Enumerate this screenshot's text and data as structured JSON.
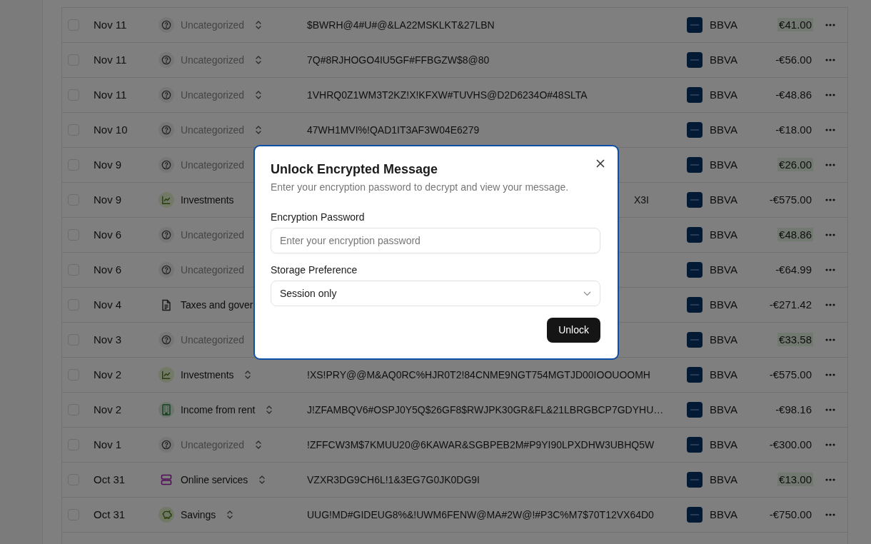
{
  "transactions": [
    {
      "selected": false,
      "date": "Nov 11",
      "category": {
        "kind": "uncategorized",
        "label": "Uncategorized"
      },
      "sorter": true,
      "description": "$BWRH@4#U#@&LA22MSKLKT&27LBN",
      "covered": false,
      "bank": "BBVA",
      "amount": "€41.00",
      "positive": true
    },
    {
      "selected": false,
      "date": "Nov 11",
      "category": {
        "kind": "uncategorized",
        "label": "Uncategorized"
      },
      "sorter": true,
      "description": "7Q#8RJHOGO4IU5GF#FFBGZW$8@80",
      "covered": false,
      "bank": "BBVA",
      "amount": "-€56.00",
      "positive": false
    },
    {
      "selected": false,
      "date": "Nov 11",
      "category": {
        "kind": "uncategorized",
        "label": "Uncategorized"
      },
      "sorter": true,
      "description": "1VHRQ0Z1WM3T2KZ!X!KFXW#TUVHS@D2D6234O#48SLTA",
      "covered": false,
      "bank": "BBVA",
      "amount": "-€48.86",
      "positive": false
    },
    {
      "selected": false,
      "date": "Nov 10",
      "category": {
        "kind": "uncategorized",
        "label": "Uncategorized"
      },
      "sorter": true,
      "description": "47WH1MVI%!QAD1IT3AF3W04E6279",
      "covered": false,
      "bank": "BBVA",
      "amount": "-€18.00",
      "positive": false
    },
    {
      "selected": false,
      "date": "Nov 9",
      "category": {
        "kind": "uncategorized",
        "label": "Uncategorized"
      },
      "sorter": false,
      "bank": "BBVA",
      "amount": "€26.00",
      "positive": true
    },
    {
      "selected": false,
      "date": "Nov 9",
      "category": {
        "kind": "investments",
        "label": "Investments"
      },
      "sorter": false,
      "description": "X3I",
      "covered": true,
      "bank": "BBVA",
      "amount": "-€575.00",
      "positive": false
    },
    {
      "selected": false,
      "date": "Nov 6",
      "category": {
        "kind": "uncategorized",
        "label": "Uncategorized"
      },
      "sorter": false,
      "bank": "BBVA",
      "amount": "€48.86",
      "positive": true
    },
    {
      "selected": false,
      "date": "Nov 6",
      "category": {
        "kind": "uncategorized",
        "label": "Uncategorized"
      },
      "sorter": false,
      "bank": "BBVA",
      "amount": "-€64.99",
      "positive": false
    },
    {
      "selected": false,
      "date": "Nov 4",
      "category": {
        "kind": "document",
        "label": "Taxes and gover"
      },
      "sorter": false,
      "bank": "BBVA",
      "amount": "-€271.42",
      "positive": false
    },
    {
      "selected": false,
      "date": "Nov 3",
      "category": {
        "kind": "uncategorized",
        "label": "Uncategorized"
      },
      "sorter": false,
      "bank": "BBVA",
      "amount": "€33.58",
      "positive": true
    },
    {
      "selected": false,
      "date": "Nov 2",
      "category": {
        "kind": "investments",
        "label": "Investments"
      },
      "sorter": true,
      "description": "!XS!PRY@@M&AQ0RC%HJR0T2!84CNME9NGT754MGTJD00IOOUOOMH",
      "covered": false,
      "bank": "BBVA",
      "amount": "-€575.00",
      "positive": false
    },
    {
      "selected": false,
      "date": "Nov 2",
      "category": {
        "kind": "building",
        "label": "Income from rent"
      },
      "sorter": true,
      "description": "J!ZFAMBQV6#OSPJ0Y5Q$26GF8$RWJPK30GR&FL&21LBRGBCP7GDYHU…",
      "covered": false,
      "bank": "BBVA",
      "amount": "-€98.16",
      "positive": false
    },
    {
      "selected": false,
      "date": "Nov 1",
      "category": {
        "kind": "uncategorized",
        "label": "Uncategorized"
      },
      "sorter": true,
      "description": "!ZFFCW3M$7KMUU20@6KAWAR&SGBPEB2M#P9YI90LPXDHW3UBHQ5W",
      "covered": false,
      "bank": "BBVA",
      "amount": "-€300.00",
      "positive": false
    },
    {
      "selected": false,
      "date": "Oct 31",
      "category": {
        "kind": "server",
        "label": "Online services"
      },
      "sorter": true,
      "description": "VZXR3DG9CH6L!1&3EG7G0JK0DG9I",
      "covered": false,
      "bank": "BBVA",
      "amount": "€13.00",
      "positive": true
    },
    {
      "selected": false,
      "date": "Oct 31",
      "category": {
        "kind": "piggy",
        "label": "Savings"
      },
      "sorter": true,
      "description": "UUG!MD#GIDEUG8%&!UWM6FENW@MA#2W@!#P3C%M7$70T12VX64D0",
      "covered": false,
      "bank": "BBVA",
      "amount": "-€750.00",
      "positive": false
    }
  ],
  "dialog": {
    "title": "Unlock Encrypted Message",
    "subtitle": "Enter your encryption password to decrypt and view your message.",
    "password": {
      "label": "Encryption Password",
      "placeholder": "Enter your encryption password"
    },
    "storage": {
      "label": "Storage Preference",
      "value": "Session only"
    },
    "button": "Unlock"
  }
}
